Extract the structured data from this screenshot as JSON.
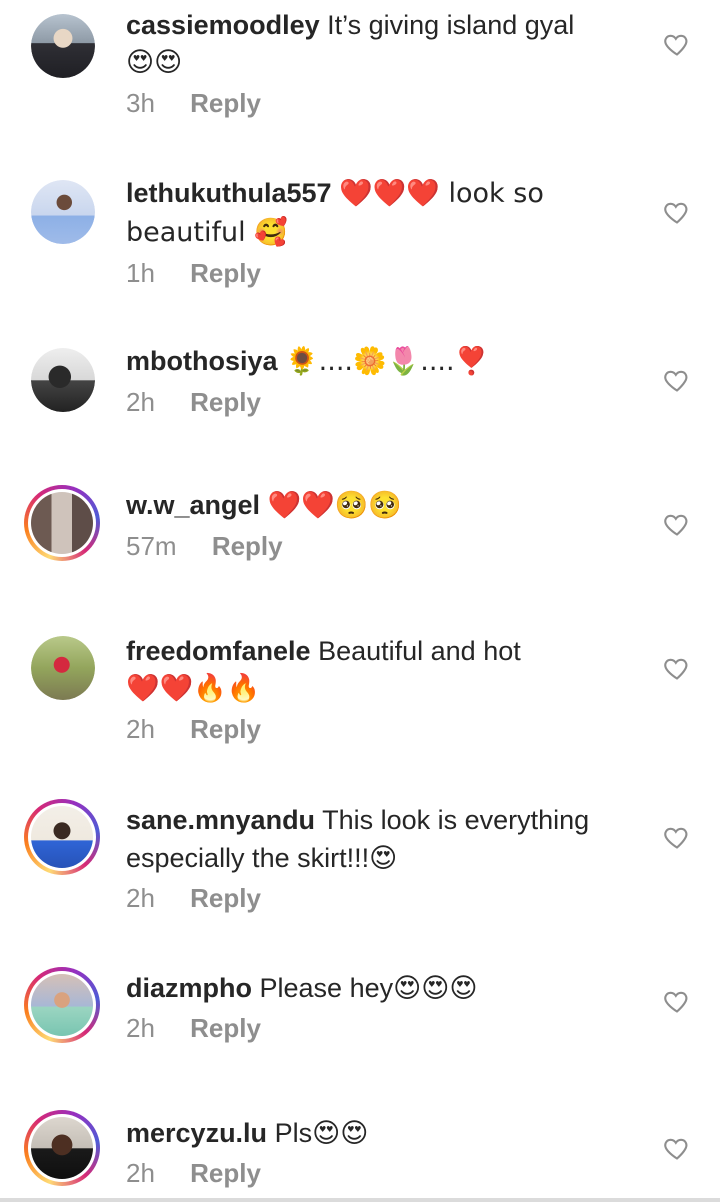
{
  "comments": [
    {
      "username": "cassiemoodley",
      "text": "It’s giving island gyal",
      "emoji_line": "😍😍",
      "time": "3h",
      "reply": "Reply",
      "avatar_icon": "avatar-photo",
      "ring": false
    },
    {
      "username": "lethukuthula557",
      "text": "❤️❤️❤️ look so beautiful 🥰",
      "emoji_line": "",
      "time": "1h",
      "reply": "Reply",
      "avatar_icon": "avatar-photo",
      "ring": false
    },
    {
      "username": "mbothosiya",
      "text": "🌻....🌼🌷....❣️",
      "emoji_line": "",
      "time": "2h",
      "reply": "Reply",
      "avatar_icon": "avatar-photo",
      "ring": false
    },
    {
      "username": "w.w_angel",
      "text": "❤️❤️🥺🥺",
      "emoji_line": "",
      "time": "57m",
      "reply": "Reply",
      "avatar_icon": "avatar-photo",
      "ring": true
    },
    {
      "username": "freedomfanele",
      "text": "Beautiful and hot",
      "emoji_line": "❤️❤️🔥🔥",
      "time": "2h",
      "reply": "Reply",
      "avatar_icon": "avatar-photo",
      "ring": false
    },
    {
      "username": "sane.mnyandu",
      "text": "This look is everything especially the skirt!!!😍",
      "emoji_line": "",
      "time": "2h",
      "reply": "Reply",
      "avatar_icon": "avatar-photo",
      "ring": true
    },
    {
      "username": "diazmpho",
      "text": "Please hey😍😍😍",
      "emoji_line": "",
      "time": "2h",
      "reply": "Reply",
      "avatar_icon": "avatar-photo",
      "ring": true
    },
    {
      "username": "mercyzu.lu",
      "text": "Pls😍😍",
      "emoji_line": "",
      "time": "2h",
      "reply": "Reply",
      "avatar_icon": "avatar-photo",
      "ring": true
    }
  ],
  "colors": {
    "text": "#262626",
    "muted": "#8e8e8e",
    "heart_outline": "#8e8e8e"
  },
  "icons": {
    "like": "heart-outline-icon"
  }
}
